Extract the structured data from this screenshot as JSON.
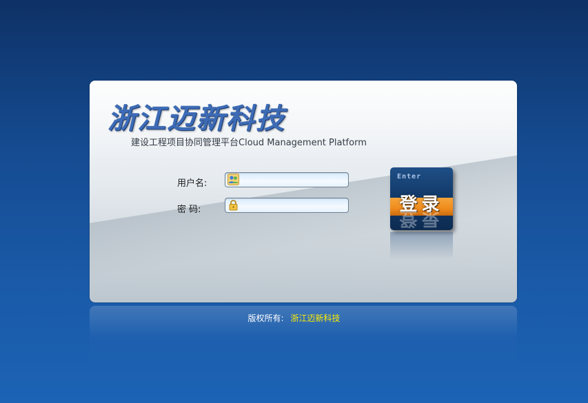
{
  "app": {
    "brand_title": "浙江迈新科技",
    "subtitle": "建设工程项目协同管理平台Cloud Management Platform"
  },
  "login": {
    "username_label": "用户名:",
    "password_label": "密  码:",
    "username_value": "",
    "password_value": "",
    "username_icon": "users-icon",
    "password_icon": "lock-icon",
    "enter_label": "Enter",
    "login_label": "登录"
  },
  "footer": {
    "copyright_prefix": "版权所有:",
    "company": "浙江迈新科技"
  },
  "colors": {
    "background_top": "#0e3166",
    "background_bottom": "#1c63b5",
    "button_accent": "#f08c1d",
    "footer_company": "#ffee00"
  }
}
